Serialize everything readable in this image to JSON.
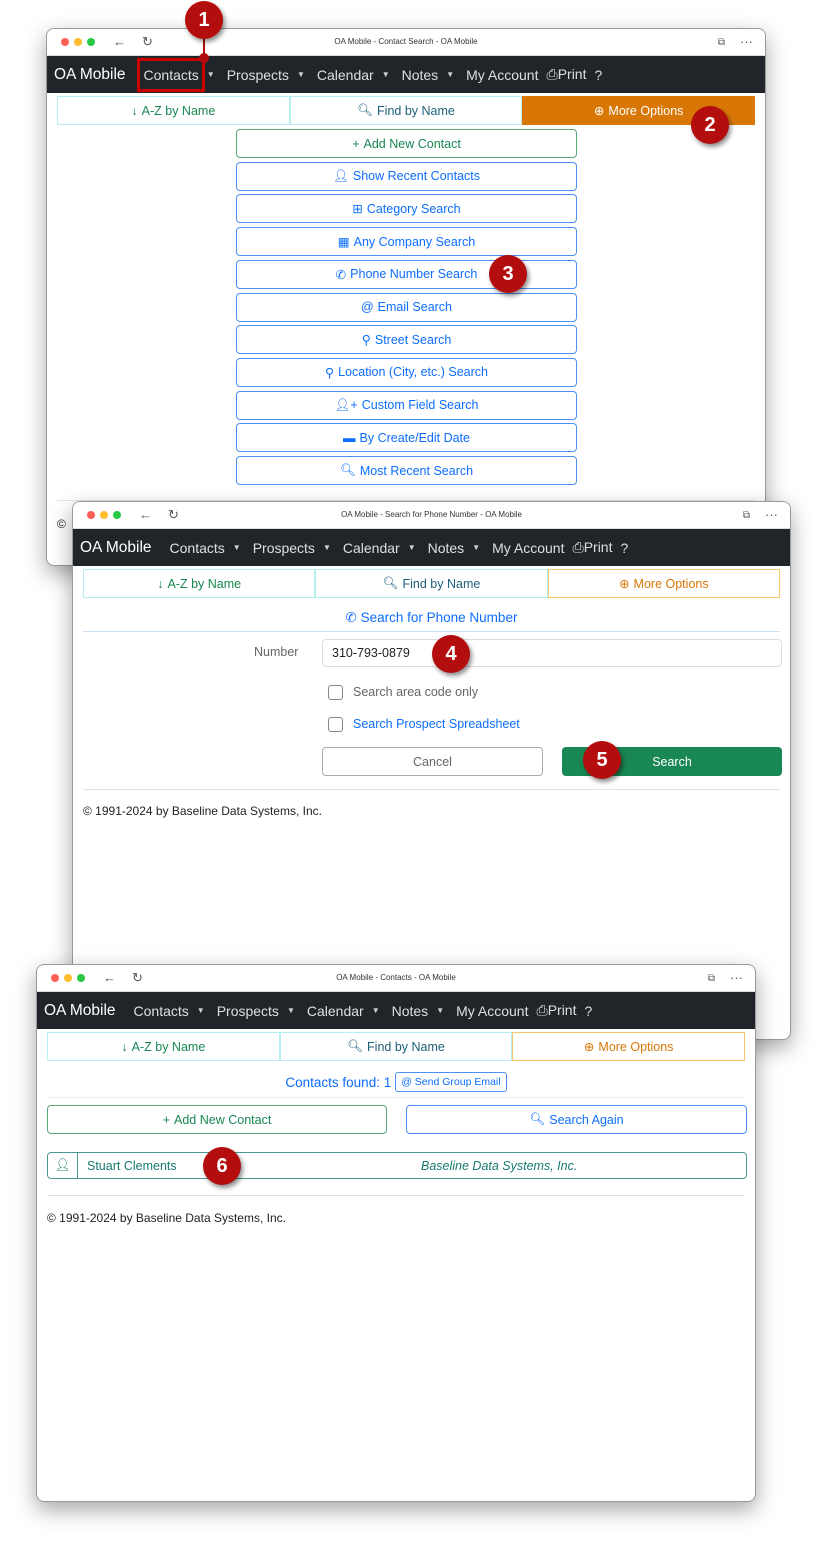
{
  "nav": {
    "brand": "OA Mobile",
    "contacts": "Contacts",
    "prospects": "Prospects",
    "calendar": "Calendar",
    "notes": "Notes",
    "account": "My Account",
    "print": "Print",
    "help": "?"
  },
  "tabs": {
    "az": "A-Z by Name",
    "find": "Find by Name",
    "more": "More Options"
  },
  "colors": {
    "navbar": "#212529",
    "accent_orange": "#d97706",
    "primary": "#0d6efd",
    "success": "#198754",
    "badge": "#b30d0d"
  },
  "window1": {
    "title": "OA Mobile - Contact Search - OA Mobile",
    "options": [
      {
        "icon": "plus-icon",
        "label": "Add New Contact"
      },
      {
        "icon": "user-icon",
        "label": "Show Recent Contacts"
      },
      {
        "icon": "table-icon",
        "label": "Category Search"
      },
      {
        "icon": "building-icon",
        "label": "Any Company Search"
      },
      {
        "icon": "phone-icon",
        "label": "Phone Number Search"
      },
      {
        "icon": "at-icon",
        "label": "Email Search"
      },
      {
        "icon": "map-pin-icon",
        "label": "Street Search"
      },
      {
        "icon": "map-pin-icon",
        "label": "Location (City, etc.) Search"
      },
      {
        "icon": "user-plus-icon",
        "label": "Custom Field Search"
      },
      {
        "icon": "calendar-icon",
        "label": "By Create/Edit Date"
      },
      {
        "icon": "search-icon",
        "label": "Most Recent Search"
      }
    ],
    "footer_partial": "©"
  },
  "window2": {
    "title": "OA Mobile - Search for Phone Number - OA Mobile",
    "heading": "Search for Phone Number",
    "number_label": "Number",
    "number_value": "310-793-0879",
    "area_code_only": "Search area code only",
    "prospect_sheet": "Search Prospect Spreadsheet",
    "cancel": "Cancel",
    "search": "Search",
    "footer": "© 1991-2024 by Baseline Data Systems, Inc."
  },
  "window3": {
    "title": "OA Mobile - Contacts - OA Mobile",
    "found": "Contacts found: 1",
    "group_email": "Send Group Email",
    "add_new": "Add New Contact",
    "search_again": "Search Again",
    "result": {
      "name": "Stuart Clements",
      "company": "Baseline Data Systems, Inc."
    },
    "footer": "© 1991-2024 by Baseline Data Systems, Inc."
  },
  "badges": [
    "1",
    "2",
    "3",
    "4",
    "5",
    "6"
  ]
}
